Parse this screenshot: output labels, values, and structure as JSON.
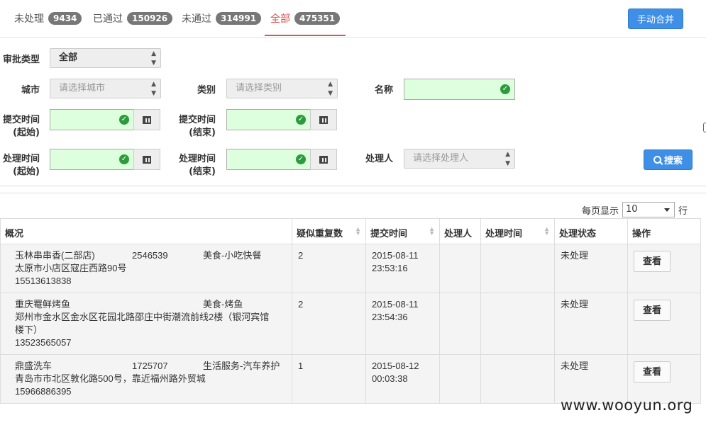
{
  "tabs": [
    {
      "label": "未处理",
      "count": "9434"
    },
    {
      "label": "已通过",
      "count": "150926"
    },
    {
      "label": "未通过",
      "count": "314991"
    },
    {
      "label": "全部",
      "count": "475351"
    }
  ],
  "merge_button": "手动合并",
  "filters": {
    "approval_type_label": "审批类型",
    "approval_type_value": "全部",
    "city_label": "城市",
    "city_placeholder": "请选择城市",
    "category_label": "类别",
    "category_placeholder": "请选择类别",
    "name_label": "名称",
    "submit_start_label_1": "提交时间",
    "submit_start_label_2": "(起始)",
    "submit_end_label_1": "提交时间",
    "submit_end_label_2": "(结束)",
    "process_start_label_1": "处理时间",
    "process_start_label_2": "(起始)",
    "process_end_label_1": "处理时间",
    "process_end_label_2": "(结束)",
    "handler_label": "处理人",
    "handler_placeholder": "请选择处理人",
    "search_button": "搜索"
  },
  "pager": {
    "prefix": "每页显示",
    "value": "10",
    "suffix": "行"
  },
  "columns": [
    "概况",
    "疑似重复数",
    "提交时间",
    "处理人",
    "处理时间",
    "处理状态",
    "操作"
  ],
  "rows": [
    {
      "name": "玉林串串香(二部店)",
      "phone_id": "2546539",
      "category": "美食-小吃快餐",
      "address": "太原市小店区寇庄西路90号",
      "tel": "15513613838",
      "dup": "2",
      "submit_date": "2015-08-11",
      "submit_time": "23:53:16",
      "handler": "",
      "process_time": "",
      "status": "未处理",
      "action": "查看"
    },
    {
      "name": "重庆罨鲜烤鱼",
      "phone_id": "",
      "category": "美食-烤鱼",
      "address": "郑州市金水区金水区花园北路邵庄中街潮流前线2楼（银河宾馆楼下）",
      "tel": "13523565057",
      "dup": "2",
      "submit_date": "2015-08-11",
      "submit_time": "23:54:36",
      "handler": "",
      "process_time": "",
      "status": "未处理",
      "action": "查看"
    },
    {
      "name": "鼎盛洗车",
      "phone_id": "1725707",
      "category": "生活服务-汽车养护",
      "address": "青岛市市北区敦化路500号，靠近福州路外贸城",
      "tel": "15966886395",
      "dup": "1",
      "submit_date": "2015-08-12",
      "submit_time": "00:03:38",
      "handler": "",
      "process_time": "",
      "status": "未处理",
      "action": "查看"
    }
  ],
  "watermark": "www.wooyun.org"
}
